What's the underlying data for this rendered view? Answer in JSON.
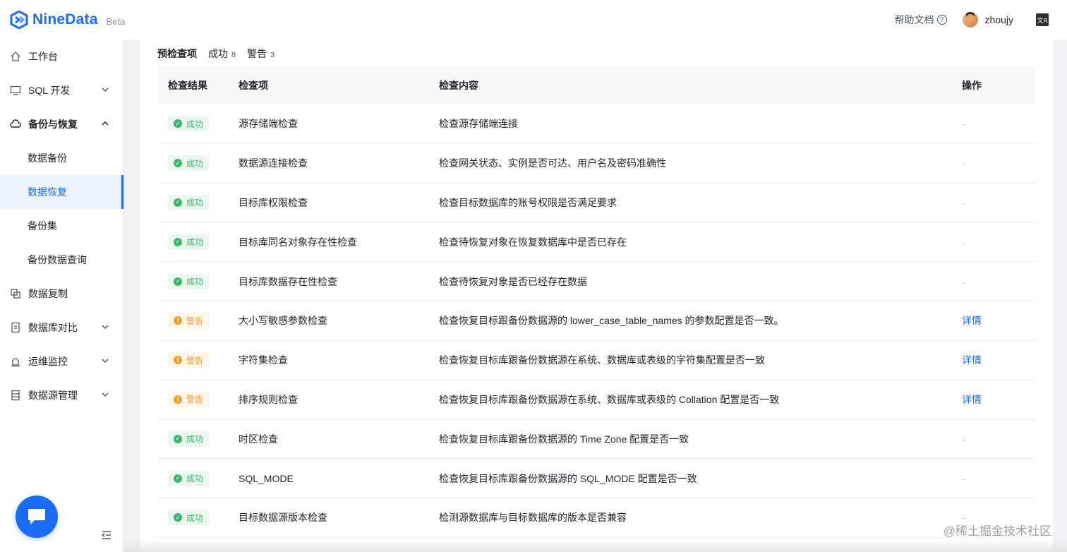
{
  "app": {
    "name": "NineData",
    "beta_label": "Beta"
  },
  "colors": {
    "brand": "#1a6cf5",
    "success": "#3bb46e",
    "warning": "#f0a02a"
  },
  "header": {
    "help_label": "帮助文档",
    "help_icon": "question-circle-icon",
    "username": "zhoujy",
    "language_icon": "translate-icon"
  },
  "sidebar": {
    "items": [
      {
        "label": "工作台",
        "icon": "home-icon"
      },
      {
        "label": "SQL 开发",
        "icon": "monitor-icon",
        "expanded": false
      },
      {
        "label": "备份与恢复",
        "icon": "cloud-sync-icon",
        "expanded": true
      },
      {
        "label": "数据复制",
        "icon": "copy-icon"
      },
      {
        "label": "数据库对比",
        "icon": "compare-icon",
        "expanded": false
      },
      {
        "label": "运维监控",
        "icon": "alarm-icon",
        "expanded": false
      },
      {
        "label": "数据源管理",
        "icon": "datasource-icon",
        "expanded": false
      }
    ],
    "subitems": [
      "数据备份",
      "数据恢复",
      "备份集",
      "备份数据查询"
    ],
    "active_subitem": "数据恢复"
  },
  "tabs": {
    "precheck_label": "预检查项",
    "success_label": "成功",
    "success_count": "8",
    "warning_label": "警告",
    "warning_count": "3"
  },
  "table": {
    "headers": [
      "检查结果",
      "检查项",
      "检查内容",
      "操作"
    ],
    "rows": [
      {
        "status": "成功",
        "item": "源存储端检查",
        "content": "检查源存储端连接",
        "action": "-"
      },
      {
        "status": "成功",
        "item": "数据源连接检查",
        "content": "检查网关状态、实例是否可达、用户名及密码准确性",
        "action": "-"
      },
      {
        "status": "成功",
        "item": "目标库权限检查",
        "content": "检查目标数据库的账号权限是否满足要求",
        "action": "-"
      },
      {
        "status": "成功",
        "item": "目标库同名对象存在性检查",
        "content": "检查待恢复对象在恢复数据库中是否已存在",
        "action": "-"
      },
      {
        "status": "成功",
        "item": "目标库数据存在性检查",
        "content": "检查待恢复对象是否已经存在数据",
        "action": "-"
      },
      {
        "status": "警告",
        "item": "大小写敏感参数检查",
        "content": "检查恢复目标跟备份数据源的 lower_case_table_names 的参数配置是否一致。",
        "action": "详情"
      },
      {
        "status": "警告",
        "item": "字符集检查",
        "content": "检查恢复目标库跟备份数据源在系统、数据库或表级的字符集配置是否一致",
        "action": "详情"
      },
      {
        "status": "警告",
        "item": "排序规则检查",
        "content": "检查恢复目标库跟备份数据源在系统、数据库或表级的 Collation 配置是否一致",
        "action": "详情"
      },
      {
        "status": "成功",
        "item": "时区检查",
        "content": "检查恢复目标库跟备份数据源的 Time Zone 配置是否一致",
        "action": "-"
      },
      {
        "status": "成功",
        "item": "SQL_MODE",
        "content": "检查恢复目标库跟备份数据源的 SQL_MODE 配置是否一致",
        "action": "-"
      },
      {
        "status": "成功",
        "item": "目标数据源版本检查",
        "content": "检测源数据库与目标数据库的版本是否兼容",
        "action": "-"
      }
    ]
  },
  "watermark": "@稀土掘金技术社区"
}
